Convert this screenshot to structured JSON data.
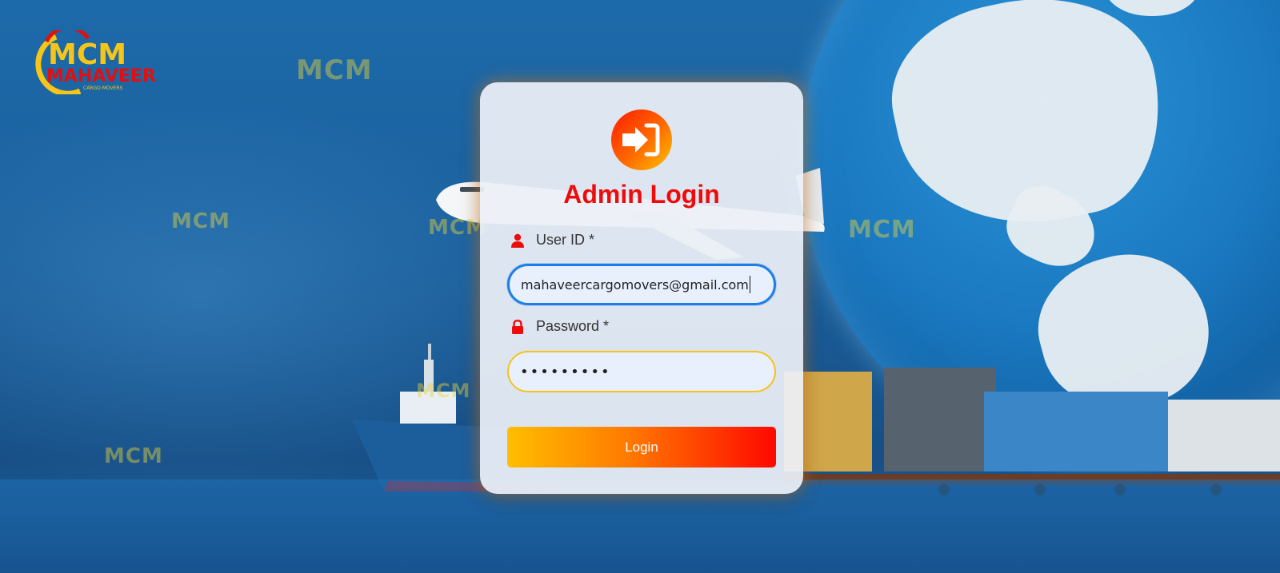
{
  "brand": {
    "logo_text_top": "MCM",
    "logo_text_bottom": "MAHAVEER",
    "logo_tagline": "CARGO MOVERS",
    "colors": {
      "logo_yellow": "#f5c518",
      "logo_red": "#e01010"
    }
  },
  "login_card": {
    "icon": "sign-in-icon",
    "title": "Admin Login",
    "user_id": {
      "label": "User ID *",
      "icon": "user-icon",
      "value": "mahaveercargomovers@gmail.com"
    },
    "password": {
      "label": "Password *",
      "icon": "lock-icon",
      "value": "•••••••••"
    },
    "submit_label": "Login"
  },
  "theme": {
    "accent_red": "#ee0b0b",
    "focus_blue": "#1e7ee6",
    "input_bg": "#e8f0fe",
    "button_gradient": [
      "#ffbe00",
      "#ff0800"
    ]
  }
}
